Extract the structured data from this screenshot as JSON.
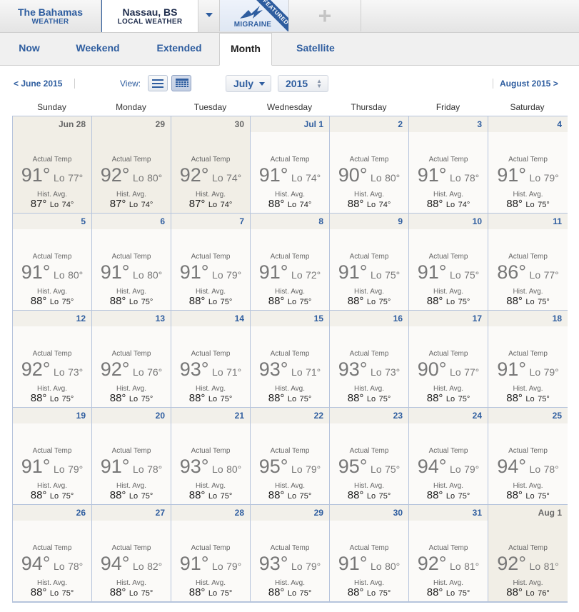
{
  "location_tabs": [
    {
      "line1": "The Bahamas",
      "line2": "WEATHER"
    },
    {
      "line1": "Nassau, BS",
      "line2": "LOCAL WEATHER"
    }
  ],
  "featured_tab": {
    "label": "MIGRAINE",
    "ribbon": "FEATURED",
    "icon": "lightning-bolt-icon"
  },
  "add_tab": {
    "icon": "plus-icon",
    "glyph": "+"
  },
  "view_tabs": [
    "Now",
    "Weekend",
    "Extended",
    "Month",
    "Satellite"
  ],
  "active_view_tab": "Month",
  "controls": {
    "prev_month": "< June 2015",
    "view_label": "View:",
    "month_select": "July",
    "year_select": "2015",
    "next_month": "August 2015 >"
  },
  "weekdays": [
    "Sunday",
    "Monday",
    "Tuesday",
    "Wednesday",
    "Thursday",
    "Friday",
    "Saturday"
  ],
  "labels": {
    "actual": "Actual Temp",
    "hist": "Hist. Avg.",
    "lo_prefix": "Lo"
  },
  "days": [
    {
      "date": "Jun 28",
      "hi": "91°",
      "lo": "77°",
      "hist_hi": "87°",
      "hist_lo": "74°",
      "other": true
    },
    {
      "date": "29",
      "hi": "92°",
      "lo": "80°",
      "hist_hi": "87°",
      "hist_lo": "74°",
      "other": true
    },
    {
      "date": "30",
      "hi": "92°",
      "lo": "74°",
      "hist_hi": "87°",
      "hist_lo": "74°",
      "other": true
    },
    {
      "date": "Jul 1",
      "hi": "91°",
      "lo": "74°",
      "hist_hi": "88°",
      "hist_lo": "74°"
    },
    {
      "date": "2",
      "hi": "90°",
      "lo": "80°",
      "hist_hi": "88°",
      "hist_lo": "74°"
    },
    {
      "date": "3",
      "hi": "91°",
      "lo": "78°",
      "hist_hi": "88°",
      "hist_lo": "74°"
    },
    {
      "date": "4",
      "hi": "91°",
      "lo": "79°",
      "hist_hi": "88°",
      "hist_lo": "75°"
    },
    {
      "date": "5",
      "hi": "91°",
      "lo": "80°",
      "hist_hi": "88°",
      "hist_lo": "75°"
    },
    {
      "date": "6",
      "hi": "91°",
      "lo": "80°",
      "hist_hi": "88°",
      "hist_lo": "75°"
    },
    {
      "date": "7",
      "hi": "91°",
      "lo": "79°",
      "hist_hi": "88°",
      "hist_lo": "75°"
    },
    {
      "date": "8",
      "hi": "91°",
      "lo": "72°",
      "hist_hi": "88°",
      "hist_lo": "75°"
    },
    {
      "date": "9",
      "hi": "91°",
      "lo": "75°",
      "hist_hi": "88°",
      "hist_lo": "75°"
    },
    {
      "date": "10",
      "hi": "91°",
      "lo": "75°",
      "hist_hi": "88°",
      "hist_lo": "75°"
    },
    {
      "date": "11",
      "hi": "86°",
      "lo": "77°",
      "hist_hi": "88°",
      "hist_lo": "75°"
    },
    {
      "date": "12",
      "hi": "92°",
      "lo": "73°",
      "hist_hi": "88°",
      "hist_lo": "75°"
    },
    {
      "date": "13",
      "hi": "92°",
      "lo": "76°",
      "hist_hi": "88°",
      "hist_lo": "75°"
    },
    {
      "date": "14",
      "hi": "93°",
      "lo": "71°",
      "hist_hi": "88°",
      "hist_lo": "75°"
    },
    {
      "date": "15",
      "hi": "93°",
      "lo": "71°",
      "hist_hi": "88°",
      "hist_lo": "75°"
    },
    {
      "date": "16",
      "hi": "93°",
      "lo": "73°",
      "hist_hi": "88°",
      "hist_lo": "75°"
    },
    {
      "date": "17",
      "hi": "90°",
      "lo": "77°",
      "hist_hi": "88°",
      "hist_lo": "75°"
    },
    {
      "date": "18",
      "hi": "91°",
      "lo": "79°",
      "hist_hi": "88°",
      "hist_lo": "75°"
    },
    {
      "date": "19",
      "hi": "91°",
      "lo": "79°",
      "hist_hi": "88°",
      "hist_lo": "75°"
    },
    {
      "date": "20",
      "hi": "91°",
      "lo": "78°",
      "hist_hi": "88°",
      "hist_lo": "75°"
    },
    {
      "date": "21",
      "hi": "93°",
      "lo": "80°",
      "hist_hi": "88°",
      "hist_lo": "75°"
    },
    {
      "date": "22",
      "hi": "95°",
      "lo": "79°",
      "hist_hi": "88°",
      "hist_lo": "75°"
    },
    {
      "date": "23",
      "hi": "95°",
      "lo": "75°",
      "hist_hi": "88°",
      "hist_lo": "75°"
    },
    {
      "date": "24",
      "hi": "94°",
      "lo": "79°",
      "hist_hi": "88°",
      "hist_lo": "75°"
    },
    {
      "date": "25",
      "hi": "94°",
      "lo": "78°",
      "hist_hi": "88°",
      "hist_lo": "75°"
    },
    {
      "date": "26",
      "hi": "94°",
      "lo": "78°",
      "hist_hi": "88°",
      "hist_lo": "75°"
    },
    {
      "date": "27",
      "hi": "94°",
      "lo": "82°",
      "hist_hi": "88°",
      "hist_lo": "75°"
    },
    {
      "date": "28",
      "hi": "91°",
      "lo": "79°",
      "hist_hi": "88°",
      "hist_lo": "75°"
    },
    {
      "date": "29",
      "hi": "93°",
      "lo": "79°",
      "hist_hi": "88°",
      "hist_lo": "75°"
    },
    {
      "date": "30",
      "hi": "91°",
      "lo": "80°",
      "hist_hi": "88°",
      "hist_lo": "75°"
    },
    {
      "date": "31",
      "hi": "92°",
      "lo": "81°",
      "hist_hi": "88°",
      "hist_lo": "75°"
    },
    {
      "date": "Aug 1",
      "hi": "92°",
      "lo": "81°",
      "hist_hi": "88°",
      "hist_lo": "76°",
      "other": true
    }
  ]
}
